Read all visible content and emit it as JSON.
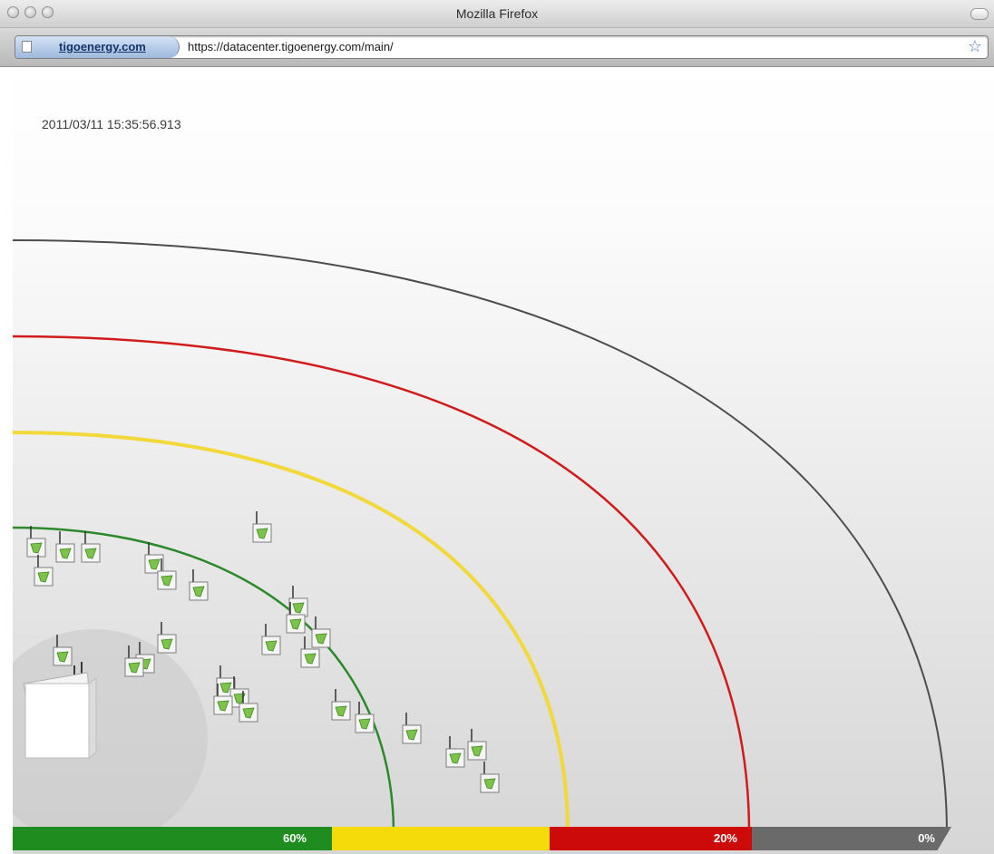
{
  "window": {
    "title": "Mozilla Firefox"
  },
  "address_bar": {
    "site_identity": "tigoenergy.com",
    "url": "https://datacenter.tigoenergy.com/main/"
  },
  "page": {
    "timestamp": "2011/03/11 15:35:56.913"
  },
  "signal_rings": [
    {
      "label": "60%",
      "color": "#2a8a2a"
    },
    {
      "label": "",
      "color": "#f2d838"
    },
    {
      "label": "20%",
      "color": "#d11a1a"
    },
    {
      "label": "0%",
      "color": "#4d4d4d"
    }
  ],
  "legend": [
    {
      "label": "60%",
      "color": "#1e8c1e"
    },
    {
      "label": "",
      "color": "#f6db0a"
    },
    {
      "label": "20%",
      "color": "#cc0a0a"
    },
    {
      "label": "0%",
      "color": "#6a6a6a"
    }
  ],
  "icons": {
    "gateway": "gateway-unit-icon",
    "node": "wireless-node-icon"
  }
}
